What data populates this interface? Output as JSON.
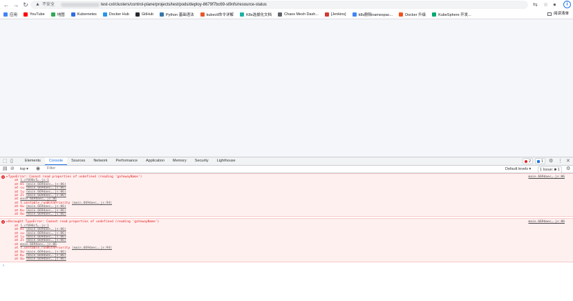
{
  "browser": {
    "not_secure": "不安全",
    "url": "test-cxl/clusters/control-plane/projects/test/pods/deploy-8679f7bc69-sl9nfs/resource-status",
    "reading_list": "阅读清单",
    "bookmarks": [
      {
        "label": "应用",
        "color": "#4285f4"
      },
      {
        "label": "YouTube",
        "color": "#ff0000"
      },
      {
        "label": "地图",
        "color": "#34a853"
      },
      {
        "label": "Kubernetes",
        "color": "#326ce5"
      },
      {
        "label": "Docker Hub",
        "color": "#2496ed"
      },
      {
        "label": "GitHub",
        "color": "#24292e"
      },
      {
        "label": "Python 基础语法",
        "color": "#3776ab"
      },
      {
        "label": "kubectl命令详解",
        "color": "#e8572c"
      },
      {
        "label": "K8s选拔化文档",
        "color": "#21b1a5"
      },
      {
        "label": "Chaos Mesh Dash...",
        "color": "#5f6368"
      },
      {
        "label": "[Jenkins]",
        "color": "#d33833"
      },
      {
        "label": "k8s删除namespac...",
        "color": "#4285f4"
      },
      {
        "label": "Docker 升级",
        "color": "#f4511e"
      },
      {
        "label": "KubeSphere 开发...",
        "color": "#00aa72"
      }
    ]
  },
  "devtools": {
    "tabs": [
      "Elements",
      "Console",
      "Sources",
      "Network",
      "Performance",
      "Application",
      "Memory",
      "Security",
      "Lighthouse"
    ],
    "active_tab": "Console",
    "error_count": "2",
    "message_count": "1",
    "context": "top ▾",
    "filter_placeholder": "Filter",
    "levels": "Default levels ▾",
    "issues": "1 Issue: ■ 1",
    "errors": [
      {
        "message": "▸TypeError: Cannot read properties of undefined (reading 'gatewayName')",
        "source": "main.669daec….js:86",
        "frames": [
          {
            "fn": "at ",
            "loc": "1.cf098c5….js:1"
          },
          {
            "fn": "at Hl ",
            "loc": "(main.669daec….js:86)"
          },
          {
            "fn": "at cu ",
            "loc": "(main.669daec….js:86)"
          },
          {
            "fn": "at lu ",
            "loc": "(main.669daec….js:86)"
          },
          {
            "fn": "at Zl ",
            "loc": "(main.669daec….js:86)"
          },
          {
            "fn": "at ",
            "loc": "main.669daec….js:86"
          },
          {
            "fn": "at t.unstable_runWithPriority ",
            "loc": "(main.669daec….js:94)"
          },
          {
            "fn": "at Uu ",
            "loc": "(main.669daec….js:86)"
          },
          {
            "fn": "at Ku ",
            "loc": "(main.669daec….js:86)"
          },
          {
            "fn": "at Ou ",
            "loc": "(main.669daec….js:86)"
          }
        ]
      },
      {
        "message": "▸Uncaught TypeError: Cannot read properties of undefined (reading 'gatewayName')",
        "source": "main.669daec….js:86",
        "frames": [
          {
            "fn": "at ",
            "loc": "1.cf098c5….js:1"
          },
          {
            "fn": "at Hl ",
            "loc": "(main.669daec….js:86)"
          },
          {
            "fn": "at cu ",
            "loc": "(main.669daec….js:86)"
          },
          {
            "fn": "at lu ",
            "loc": "(main.669daec….js:86)"
          },
          {
            "fn": "at Zl ",
            "loc": "(main.669daec….js:86)"
          },
          {
            "fn": "at ",
            "loc": "main.669daec….js:86"
          },
          {
            "fn": "at t.unstable_runWithPriority ",
            "loc": "(main.669daec….js:94)"
          },
          {
            "fn": "at Vu ",
            "loc": "(main.669daec….js:86)"
          },
          {
            "fn": "at Ku ",
            "loc": "(main.669daec….js:86)"
          },
          {
            "fn": "at Ou ",
            "loc": "(main.669daec….js:86)"
          }
        ]
      }
    ],
    "prompt": "›"
  }
}
